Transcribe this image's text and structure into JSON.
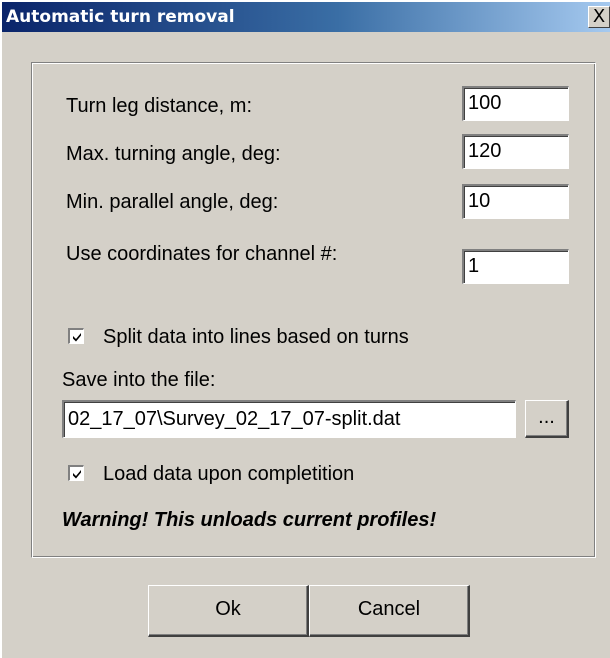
{
  "window": {
    "title": "Automatic turn removal",
    "close_symbol": "X"
  },
  "params": [
    {
      "label": "Turn leg distance, m:",
      "value": "100"
    },
    {
      "label": "Max. turning angle, deg:",
      "value": "120"
    },
    {
      "label": "Min. parallel angle, deg:",
      "value": "10"
    },
    {
      "label": "Use coordinates for channel #:",
      "value": "1"
    }
  ],
  "split": {
    "label": "Split data into lines based on turns",
    "checked": true
  },
  "save": {
    "label": "Save into the file:",
    "path": "02_17_07\\Survey_02_17_07-split.dat",
    "browse_label": "..."
  },
  "load": {
    "label": "Load data upon completition",
    "checked": true
  },
  "warning": "Warning! This unloads current profiles!",
  "buttons": {
    "ok": "Ok",
    "cancel": "Cancel"
  },
  "icons": {
    "close": "close-icon",
    "check": "checkmark-icon"
  }
}
